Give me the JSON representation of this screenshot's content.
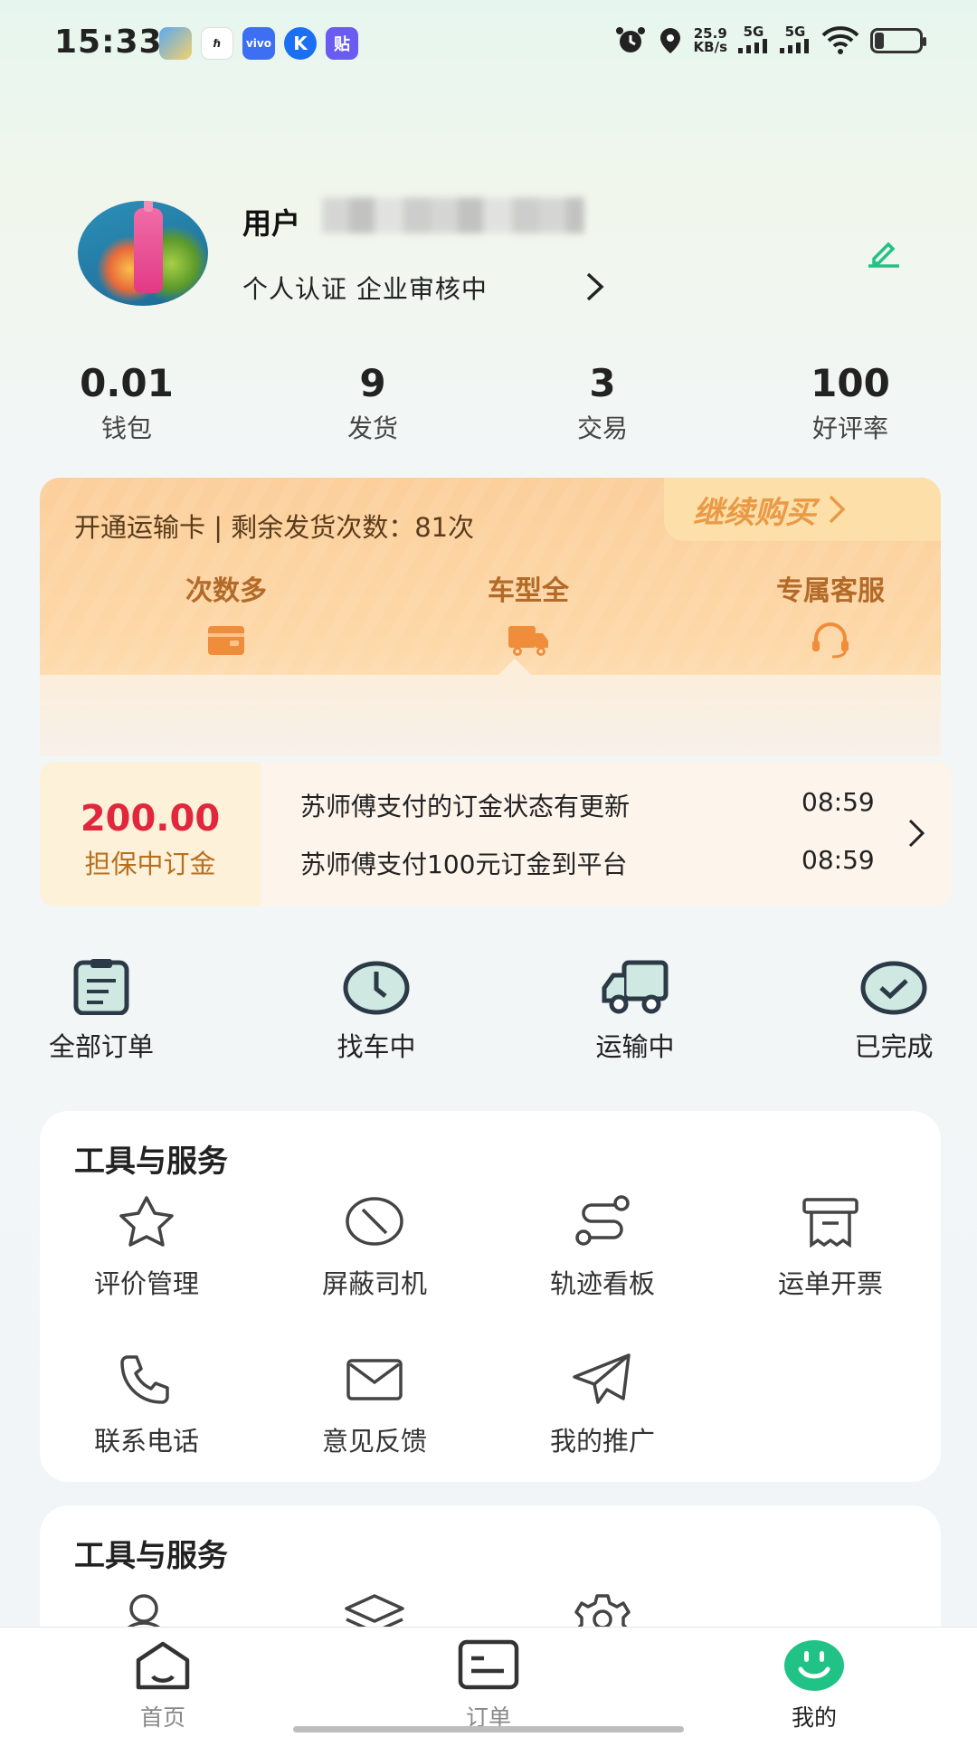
{
  "status_bar": {
    "time": "15:33",
    "network_speed": "25.9",
    "network_unit": "KB/s",
    "signal_1": "5G",
    "signal_2": "5G",
    "app_icons": [
      "baidu-icon",
      "lanhu-icon",
      "vivo-icon",
      "k-icon",
      "tie-icon"
    ],
    "app_labels": {
      "vivo": "vivo",
      "k": "K",
      "tie": "贴"
    }
  },
  "profile": {
    "name": "用户",
    "verification": "个人认证 企业审核中"
  },
  "stats": [
    {
      "value": "0.01",
      "label": "钱包"
    },
    {
      "value": "9",
      "label": "发货"
    },
    {
      "value": "3",
      "label": "交易"
    },
    {
      "value": "100",
      "label": "好评率"
    }
  ],
  "card": {
    "title": "开通运输卡 | 剩余发货次数：81次",
    "buy_label": "继续购买",
    "features": [
      {
        "label": "次数多",
        "icon": "wallet-icon"
      },
      {
        "label": "车型全",
        "icon": "truck-icon"
      },
      {
        "label": "专属客服",
        "icon": "headset-icon"
      }
    ]
  },
  "deposit": {
    "amount": "200.00",
    "label": "担保中订金",
    "messages": [
      {
        "text": "苏师傅支付的订金状态有更新",
        "time": "08:59"
      },
      {
        "text": "苏师傅支付100元订金到平台",
        "time": "08:59"
      }
    ]
  },
  "orders": [
    {
      "label": "全部订单",
      "icon": "clipboard-icon"
    },
    {
      "label": "找车中",
      "icon": "clock-icon"
    },
    {
      "label": "运输中",
      "icon": "truck-icon"
    },
    {
      "label": "已完成",
      "icon": "check-circle-icon"
    }
  ],
  "tools_1": {
    "title": "工具与服务",
    "items": [
      {
        "label": "评价管理",
        "icon": "star-icon"
      },
      {
        "label": "屏蔽司机",
        "icon": "block-icon"
      },
      {
        "label": "轨迹看板",
        "icon": "route-icon"
      },
      {
        "label": "运单开票",
        "icon": "invoice-icon"
      },
      {
        "label": "联系电话",
        "icon": "phone-icon"
      },
      {
        "label": "意见反馈",
        "icon": "mail-icon"
      },
      {
        "label": "我的推广",
        "icon": "send-icon"
      }
    ]
  },
  "tools_2": {
    "title": "工具与服务",
    "items": [
      {
        "icon": "user-icon"
      },
      {
        "icon": "layers-icon"
      },
      {
        "icon": "settings-icon"
      }
    ]
  },
  "tabbar": [
    {
      "label": "首页",
      "icon": "home-icon",
      "active": false
    },
    {
      "label": "订单",
      "icon": "order-icon",
      "active": false
    },
    {
      "label": "我的",
      "icon": "smile-icon",
      "active": true
    }
  ],
  "colors": {
    "accent": "#21c285",
    "card_orange": "#fccf9b",
    "deposit_red": "#e0273c",
    "deposit_brown": "#b8701f",
    "icon_dark": "#2b3a46",
    "icon_teal": "#cfe9e2"
  }
}
